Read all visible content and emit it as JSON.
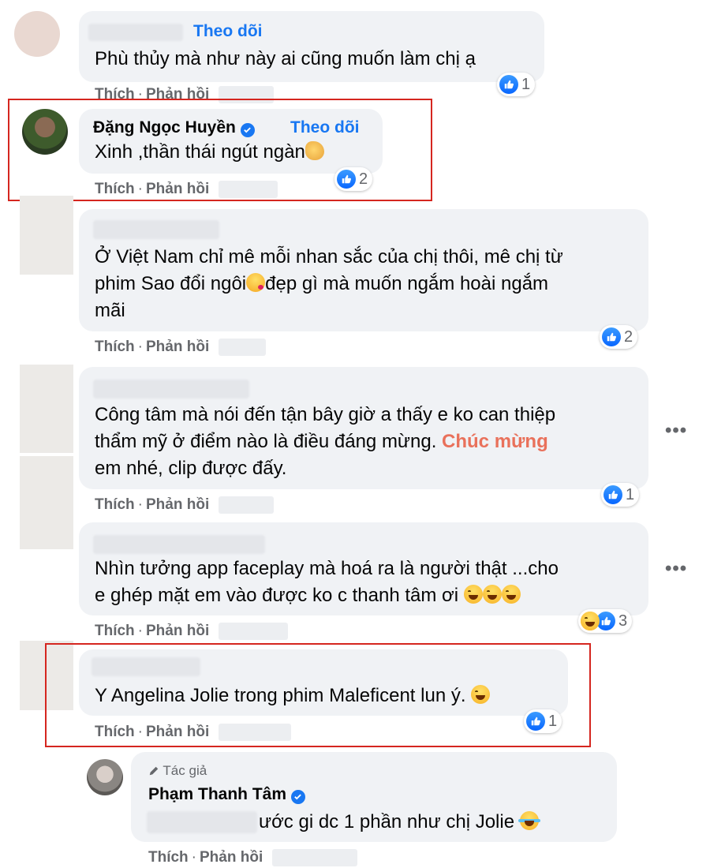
{
  "comments": [
    {
      "follow_label": "Theo dõi",
      "text": "Phù thủy mà như này ai cũng muốn làm chị ạ",
      "like_label": "Thích",
      "reply_label": "Phản hồi",
      "reaction_count": "1",
      "reaction_icons": [
        "like-icon"
      ]
    },
    {
      "name": "Đặng Ngọc Huyền",
      "verified": true,
      "follow_label": "Theo dõi",
      "text": "Xinh ,thần thái ngút ngàn",
      "emoji": "clapping-hands-icon",
      "like_label": "Thích",
      "reply_label": "Phản hồi",
      "reaction_count": "2",
      "reaction_icons": [
        "like-icon"
      ],
      "highlighted": true
    },
    {
      "text_line1": "Ở Việt Nam chỉ mê mỗi nhan sắc của chị thôi, mê chị từ",
      "text_line2a": "phim Sao đổi ngôi",
      "text_line2b": "đẹp gì mà muốn ngắm hoài ngắm",
      "text_line3": "mãi",
      "emoji": "kissing-face-icon",
      "like_label": "Thích",
      "reply_label": "Phản hồi",
      "reaction_count": "2",
      "reaction_icons": [
        "like-icon"
      ]
    },
    {
      "text_line1": "Công tâm mà nói đến tận bây giờ a thấy e ko can thiệp",
      "text_line2": "thẩm mỹ ở điểm nào là điều đáng mừng. ",
      "highlight": "Chúc mừng",
      "text_line3": "em nhé, clip được đấy.",
      "like_label": "Thích",
      "reply_label": "Phản hồi",
      "reaction_count": "1",
      "reaction_icons": [
        "like-icon"
      ],
      "more_label": "•••"
    },
    {
      "text_line1": "Nhìn tưởng app faceplay mà hoá ra là người thật ...cho",
      "text_line2": "e ghép mặt em vào được ko c thanh tâm ơi",
      "emoji": "laughing-face-icon",
      "like_label": "Thích",
      "reply_label": "Phản hồi",
      "reaction_count": "3",
      "reaction_icons": [
        "haha-icon",
        "like-icon"
      ],
      "more_label": "•••"
    },
    {
      "text": "Y Angelina Jolie trong phim Maleficent lun ý.",
      "emoji": "laughing-face-icon",
      "like_label": "Thích",
      "reply_label": "Phản hồi",
      "reaction_count": "1",
      "reaction_icons": [
        "like-icon"
      ],
      "highlighted": true
    }
  ],
  "reply": {
    "author_tag": "Tác giả",
    "name": "Phạm Thanh Tâm",
    "verified": true,
    "text": "ước gi dc 1 phần như chị Jolie",
    "emoji": "tears-of-joy-icon",
    "like_label": "Thích",
    "reply_label": "Phản hồi"
  },
  "colors": {
    "bubble": "#f0f2f5",
    "link_blue": "#1877f2",
    "highlight_orange": "#e9715b",
    "annotation_red": "#d5261f",
    "meta_gray": "#65676b"
  }
}
